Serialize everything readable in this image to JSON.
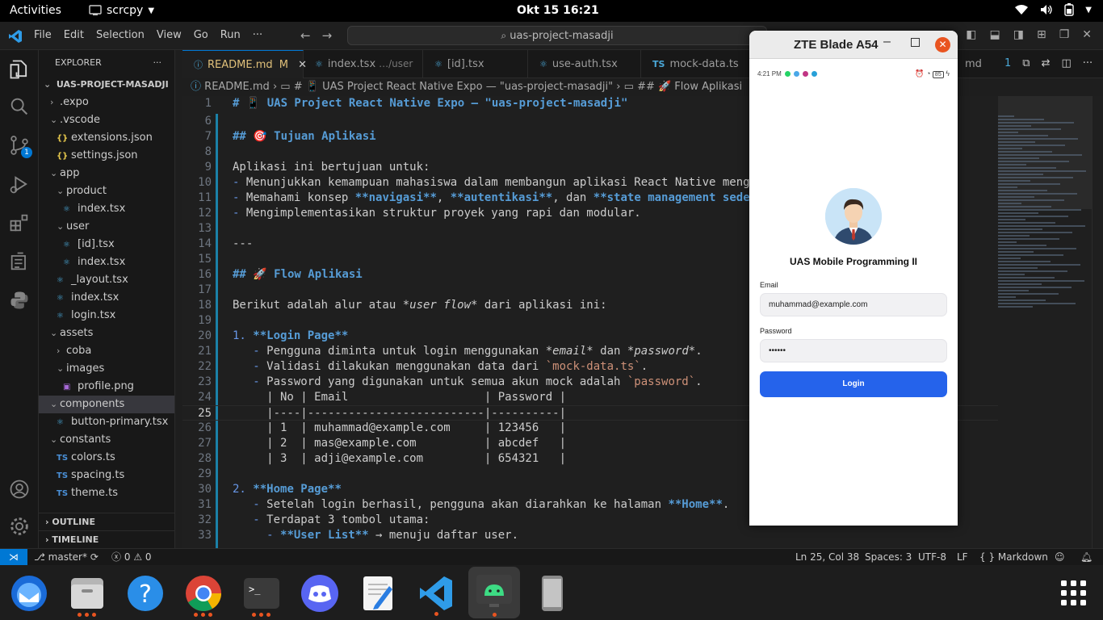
{
  "topbar": {
    "activities": "Activities",
    "app_name": "scrcpy",
    "clock": "Okt 15  16:21"
  },
  "vscode": {
    "menu": [
      "File",
      "Edit",
      "Selection",
      "View",
      "Go",
      "Run",
      "···"
    ],
    "command_center": "uas-project-masadji",
    "explorer_title": "EXPLORER",
    "project_root": "UAS-PROJECT-MASADJI",
    "tree": [
      {
        "label": ".expo",
        "type": "folder-closed",
        "depth": 1
      },
      {
        "label": ".vscode",
        "type": "folder-open",
        "depth": 1
      },
      {
        "label": "extensions.json",
        "type": "json",
        "depth": 2
      },
      {
        "label": "settings.json",
        "type": "json",
        "depth": 2
      },
      {
        "label": "app",
        "type": "folder-open",
        "depth": 1
      },
      {
        "label": "product",
        "type": "folder-open",
        "depth": 2
      },
      {
        "label": "index.tsx",
        "type": "tsx",
        "depth": 3
      },
      {
        "label": "user",
        "type": "folder-open",
        "depth": 2
      },
      {
        "label": "[id].tsx",
        "type": "tsx",
        "depth": 3
      },
      {
        "label": "index.tsx",
        "type": "tsx",
        "depth": 3
      },
      {
        "label": "_layout.tsx",
        "type": "tsx",
        "depth": 2
      },
      {
        "label": "index.tsx",
        "type": "tsx",
        "depth": 2
      },
      {
        "label": "login.tsx",
        "type": "tsx",
        "depth": 2
      },
      {
        "label": "assets",
        "type": "folder-open",
        "depth": 1
      },
      {
        "label": "coba",
        "type": "folder-closed",
        "depth": 2
      },
      {
        "label": "images",
        "type": "folder-open",
        "depth": 2
      },
      {
        "label": "profile.png",
        "type": "png",
        "depth": 3
      },
      {
        "label": "components",
        "type": "folder-open",
        "depth": 1,
        "selected": true
      },
      {
        "label": "button-primary.tsx",
        "type": "tsx",
        "depth": 2
      },
      {
        "label": "constants",
        "type": "folder-open",
        "depth": 1
      },
      {
        "label": "colors.ts",
        "type": "ts",
        "depth": 2
      },
      {
        "label": "spacing.ts",
        "type": "ts",
        "depth": 2
      },
      {
        "label": "theme.ts",
        "type": "ts",
        "depth": 2
      }
    ],
    "outline": "OUTLINE",
    "timeline": "TIMELINE",
    "tabs": [
      {
        "label": "README.md",
        "modified": "M",
        "active": true
      },
      {
        "label": "index.tsx",
        "hint": "…/user"
      },
      {
        "label": "[id].tsx"
      },
      {
        "label": "use-auth.tsx"
      },
      {
        "label": "mock-data.ts"
      }
    ],
    "tab_tail": "md",
    "breadcrumb": {
      "file": "README.md",
      "h1": "# 📱 UAS Project React Native Expo — \"uas-project-masadji\"",
      "h2": "## 🚀 Flow Aplikasi"
    },
    "lines": [
      {
        "n": "1",
        "parts": [
          {
            "c": "h",
            "t": "# 📱 UAS Project React Native Expo — \"uas-project-masadji\""
          }
        ]
      },
      {
        "n": "6",
        "parts": []
      },
      {
        "n": "7",
        "parts": [
          {
            "c": "h",
            "t": "## 🎯 Tujuan Aplikasi"
          }
        ]
      },
      {
        "n": "8",
        "parts": []
      },
      {
        "n": "9",
        "parts": [
          {
            "c": "",
            "t": "Aplikasi ini bertujuan untuk:"
          }
        ]
      },
      {
        "n": "10",
        "parts": [
          {
            "c": "li",
            "t": "-"
          },
          {
            "c": "",
            "t": " Menunjukkan kemampuan mahasiswa dalam membangun aplikasi React Native meng"
          }
        ]
      },
      {
        "n": "11",
        "parts": [
          {
            "c": "li",
            "t": "-"
          },
          {
            "c": "",
            "t": " Memahami konsep "
          },
          {
            "c": "b",
            "t": "**navigasi**"
          },
          {
            "c": "",
            "t": ", "
          },
          {
            "c": "b",
            "t": "**autentikasi**"
          },
          {
            "c": "",
            "t": ", dan "
          },
          {
            "c": "b",
            "t": "**state management sede"
          }
        ]
      },
      {
        "n": "12",
        "parts": [
          {
            "c": "li",
            "t": "-"
          },
          {
            "c": "",
            "t": " Mengimplementasikan struktur proyek yang rapi dan modular."
          }
        ]
      },
      {
        "n": "13",
        "parts": []
      },
      {
        "n": "14",
        "parts": [
          {
            "c": "",
            "t": "---"
          }
        ]
      },
      {
        "n": "15",
        "parts": []
      },
      {
        "n": "16",
        "parts": [
          {
            "c": "h",
            "t": "## 🚀 Flow Aplikasi"
          }
        ]
      },
      {
        "n": "17",
        "parts": []
      },
      {
        "n": "18",
        "parts": [
          {
            "c": "",
            "t": "Berikut adalah alur atau "
          },
          {
            "c": "it",
            "t": "*user flow*"
          },
          {
            "c": "",
            "t": " dari aplikasi ini:"
          }
        ]
      },
      {
        "n": "19",
        "parts": []
      },
      {
        "n": "20",
        "parts": [
          {
            "c": "li",
            "t": "1."
          },
          {
            "c": "",
            "t": " "
          },
          {
            "c": "b",
            "t": "**Login Page**"
          }
        ]
      },
      {
        "n": "21",
        "parts": [
          {
            "c": "li",
            "t": "   -"
          },
          {
            "c": "",
            "t": " Pengguna diminta untuk login menggunakan "
          },
          {
            "c": "it",
            "t": "*email*"
          },
          {
            "c": "",
            "t": " dan "
          },
          {
            "c": "it",
            "t": "*password*"
          },
          {
            "c": "",
            "t": "."
          }
        ]
      },
      {
        "n": "22",
        "parts": [
          {
            "c": "li",
            "t": "   -"
          },
          {
            "c": "",
            "t": " Validasi dilakukan menggunakan data dari "
          },
          {
            "c": "cd",
            "t": "`mock-data.ts`"
          },
          {
            "c": "",
            "t": "."
          }
        ]
      },
      {
        "n": "23",
        "parts": [
          {
            "c": "li",
            "t": "   -"
          },
          {
            "c": "",
            "t": " Password yang digunakan untuk semua akun mock adalah "
          },
          {
            "c": "cd",
            "t": "`password`"
          },
          {
            "c": "",
            "t": "."
          }
        ]
      },
      {
        "n": "24",
        "parts": [
          {
            "c": "",
            "t": "     | No | Email                    | Password |"
          }
        ]
      },
      {
        "n": "25",
        "parts": [
          {
            "c": "",
            "t": "     |----|--------------------------|----------|"
          }
        ],
        "current": true
      },
      {
        "n": "26",
        "parts": [
          {
            "c": "",
            "t": "     | 1  | muhammad@example.com     | 123456   |"
          }
        ]
      },
      {
        "n": "27",
        "parts": [
          {
            "c": "",
            "t": "     | 2  | mas@example.com          | abcdef   |"
          }
        ]
      },
      {
        "n": "28",
        "parts": [
          {
            "c": "",
            "t": "     | 3  | adji@example.com         | 654321   |"
          }
        ]
      },
      {
        "n": "29",
        "parts": []
      },
      {
        "n": "30",
        "parts": [
          {
            "c": "li",
            "t": "2."
          },
          {
            "c": "",
            "t": " "
          },
          {
            "c": "b",
            "t": "**Home Page**"
          }
        ]
      },
      {
        "n": "31",
        "parts": [
          {
            "c": "li",
            "t": "   -"
          },
          {
            "c": "",
            "t": " Setelah login berhasil, pengguna akan diarahkan ke halaman "
          },
          {
            "c": "b",
            "t": "**Home**"
          },
          {
            "c": "",
            "t": "."
          }
        ]
      },
      {
        "n": "32",
        "parts": [
          {
            "c": "li",
            "t": "   -"
          },
          {
            "c": "",
            "t": " Terdapat 3 tombol utama:"
          }
        ]
      },
      {
        "n": "33",
        "parts": [
          {
            "c": "li",
            "t": "     -"
          },
          {
            "c": "",
            "t": " "
          },
          {
            "c": "b",
            "t": "**User List**"
          },
          {
            "c": "",
            "t": " → menuju daftar user."
          }
        ]
      }
    ],
    "status": {
      "branch": "master*",
      "problems": "0",
      "warnings": "0",
      "position": "Ln 25, Col 38",
      "spaces": "Spaces: 3",
      "encoding": "UTF-8",
      "eol": "LF",
      "language": "Markdown",
      "language_icon": "{ }"
    },
    "badge_count": "1",
    "accent": "#0078d4"
  },
  "scrcpy": {
    "title": "ZTE Blade A54",
    "phone": {
      "time": "4:21 PM",
      "battery": "85",
      "app_title": "UAS Mobile Programming II",
      "email_label": "Email",
      "email_value": "muhammad@example.com",
      "password_label": "Password",
      "password_value": "••••••",
      "login_button": "Login",
      "button_color": "#2563eb"
    }
  },
  "dock": [
    "thunderbird-icon",
    "files-icon",
    "help-icon",
    "chrome-icon",
    "terminal-icon",
    "discord-icon",
    "text-editor-icon",
    "vscode-icon",
    "android-scrcpy-icon",
    "phone-icon",
    "app-grid-icon"
  ]
}
